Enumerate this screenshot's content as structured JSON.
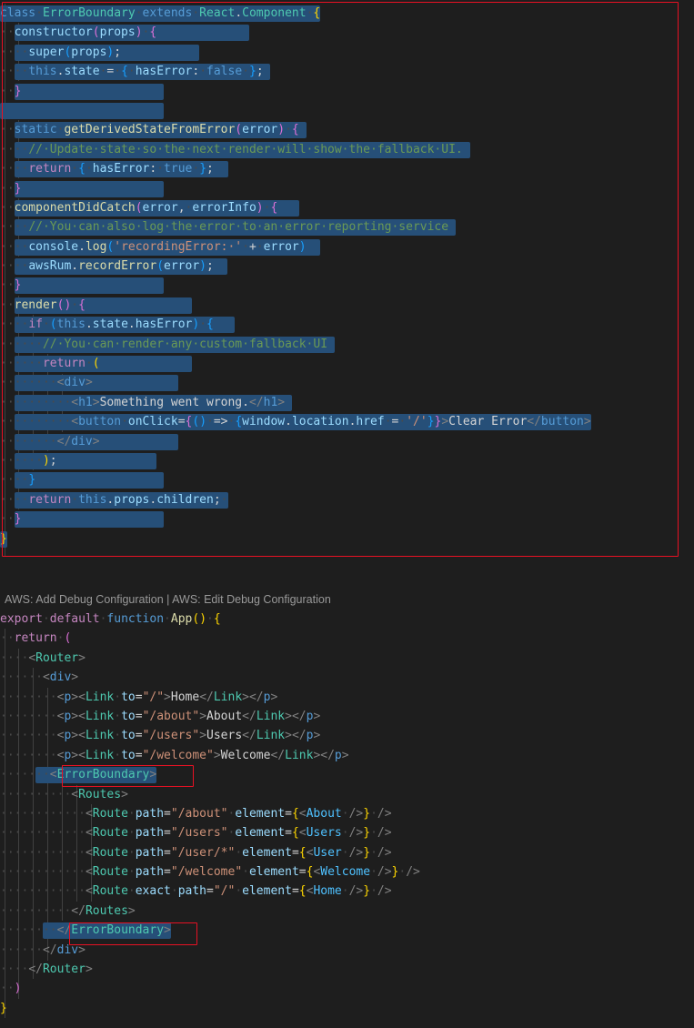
{
  "theme": {
    "editor_background": "#1e1e1e",
    "selection_background": "#264f78",
    "annotation_color": "#e81123",
    "indent_guide_color": "#404040",
    "whitespace_dot_color": "#4a4a4a",
    "codelens_color": "#999999"
  },
  "codelens": {
    "text": "AWS: Add Debug Configuration | AWS: Edit Debug Configuration"
  },
  "error_boundary_file": {
    "lines": [
      "class ErrorBoundary extends React.Component {",
      "  constructor(props) {",
      "    super(props);",
      "    this.state = { hasError: false };",
      "  }",
      "",
      "  static getDerivedStateFromError(error) {",
      "    // Update state so the next render will show the fallback UI.",
      "    return { hasError: true };",
      "  }",
      "  componentDidCatch(error, errorInfo) {",
      "    // You can also log the error to an error reporting service",
      "    console.log('recordingError: ' + error)",
      "    awsRum.recordError(error);",
      "  }",
      "  render() {",
      "    if (this.state.hasError) {",
      "      // You can render any custom fallback UI",
      "      return (",
      "        <div>",
      "          <h1>Something went wrong.</h1>",
      "          <button onClick={() => {window.location.href = '/'}}>Clear Error</button>",
      "        </div>",
      "      );",
      "    }",
      "    return this.props.children;",
      "  }",
      "}"
    ]
  },
  "app_file": {
    "lines": [
      "export default function App() {",
      "  return (",
      "    <Router>",
      "      <div>",
      "        <p><Link to=\"/\">Home</Link></p>",
      "        <p><Link to=\"/about\">About</Link></p>",
      "        <p><Link to=\"/users\">Users</Link></p>",
      "        <p><Link to=\"/welcome\">Welcome</Link></p>",
      "        <ErrorBoundary>",
      "          <Routes>",
      "            <Route path=\"/about\" element={<About />} />",
      "            <Route path=\"/users\" element={<Users />} />",
      "            <Route path=\"/user/*\" element={<User />} />",
      "            <Route path=\"/welcome\" element={<Welcome />} />",
      "            <Route exact path=\"/\" element={<Home />} />",
      "          </Routes>",
      "        </ErrorBoundary>",
      "      </div>",
      "    </Router>",
      "  )",
      "}"
    ]
  },
  "annotations": [
    {
      "name": "main-code-highlight",
      "target": "error-boundary-class-block"
    },
    {
      "name": "error-boundary-open-tag-highlight",
      "target": "<ErrorBoundary>"
    },
    {
      "name": "error-boundary-close-tag-highlight",
      "target": "</ErrorBoundary>"
    }
  ]
}
